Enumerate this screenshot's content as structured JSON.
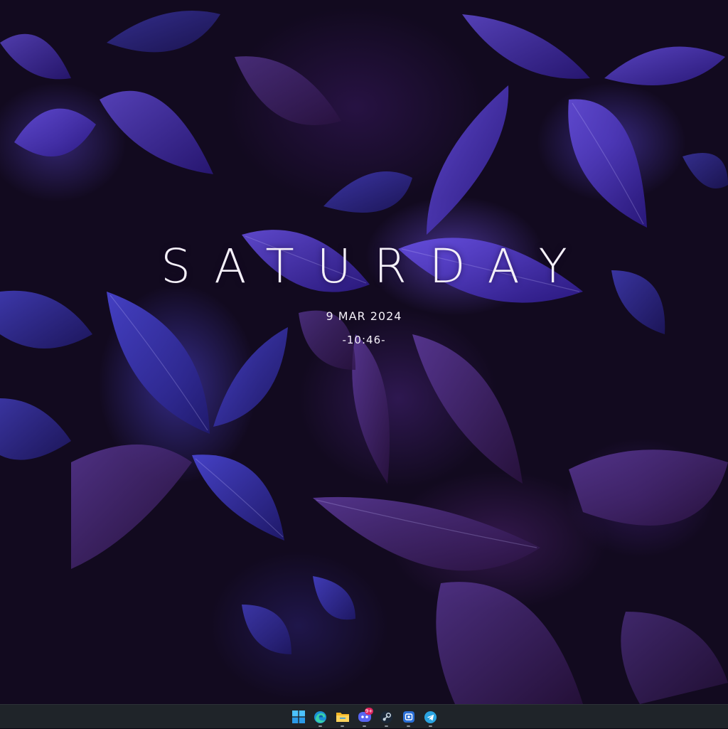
{
  "clock_widget": {
    "day": "SATURDAY",
    "date": "9 MAR 2024",
    "time": "-10:46-"
  },
  "taskbar": {
    "apps": [
      {
        "name": "Start",
        "icon": "windows-logo-icon",
        "running": false
      },
      {
        "name": "Microsoft Edge",
        "icon": "edge-icon",
        "running": true
      },
      {
        "name": "File Explorer",
        "icon": "folder-icon",
        "running": true
      },
      {
        "name": "Discord",
        "icon": "discord-icon",
        "running": true,
        "badge": "9+"
      },
      {
        "name": "Steam",
        "icon": "steam-icon",
        "running": true
      },
      {
        "name": "Screen capture",
        "icon": "capture-icon",
        "running": true
      },
      {
        "name": "Telegram",
        "icon": "telegram-icon",
        "running": true
      }
    ]
  },
  "colors": {
    "taskbar_bg": "#1f2429",
    "clock_text": "#f4f0f8",
    "wallpaper_leaf": "#5a3fd6",
    "wallpaper_dark": "#120a1f"
  }
}
